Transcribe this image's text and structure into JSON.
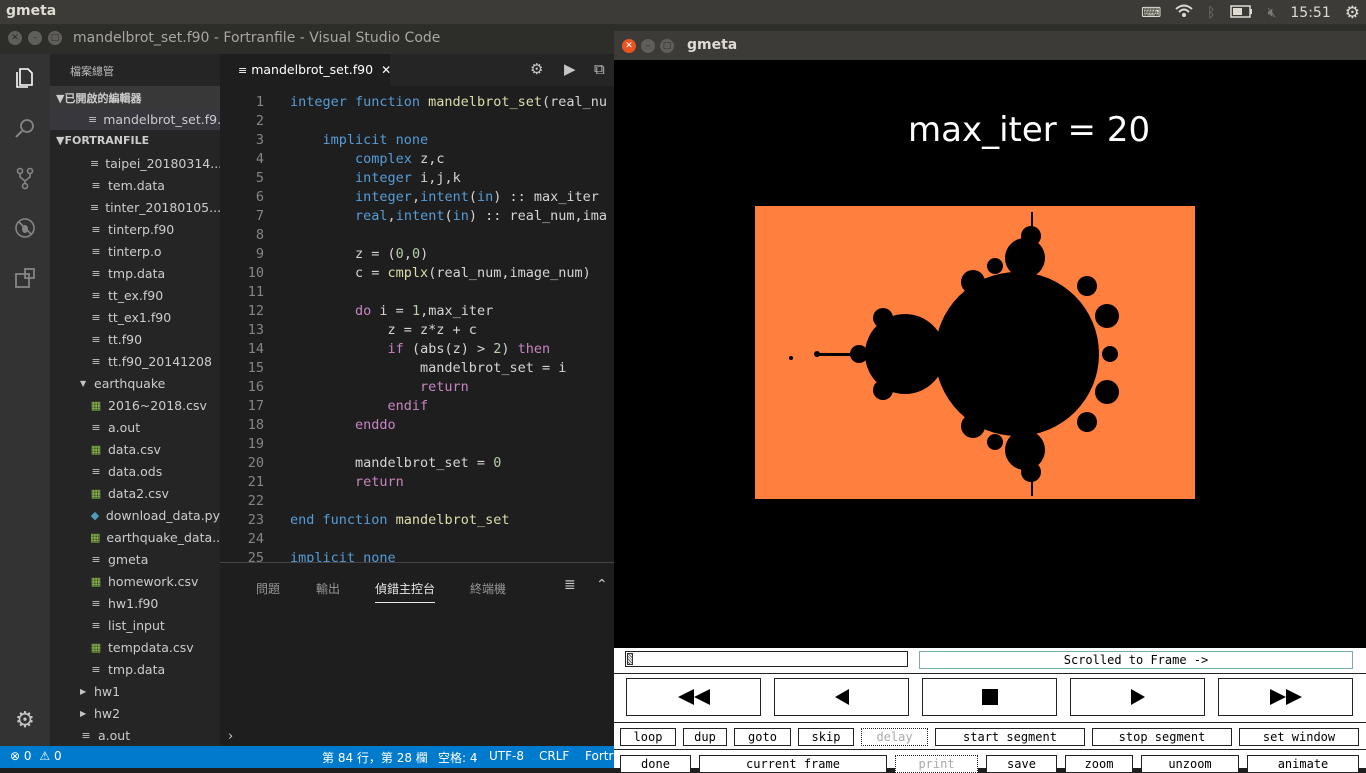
{
  "topbar": {
    "app_name": "gmeta",
    "clock": "15:51",
    "icons": [
      "keyboard-icon",
      "wifi-icon",
      "bluetooth-icon",
      "battery-icon",
      "volume-mute-icon",
      "settings-gear-icon"
    ]
  },
  "vscode": {
    "window_title": "mandelbrot_set.f90 - Fortranfile - Visual Studio Code",
    "explorer_header": "檔案總管",
    "open_editors_label": "已開啟的編輯器",
    "open_editor_file": "mandelbrot_set.f9...",
    "project_label": "FORTRANFILE",
    "files": [
      {
        "name": "taipei_20180314...",
        "type": "file",
        "depth": 1
      },
      {
        "name": "tem.data",
        "type": "file",
        "depth": 1
      },
      {
        "name": "tinter_20180105....",
        "type": "file",
        "depth": 1
      },
      {
        "name": "tinterp.f90",
        "type": "file",
        "depth": 1
      },
      {
        "name": "tinterp.o",
        "type": "file",
        "depth": 1
      },
      {
        "name": "tmp.data",
        "type": "file",
        "depth": 1
      },
      {
        "name": "tt_ex.f90",
        "type": "file",
        "depth": 1
      },
      {
        "name": "tt_ex1.f90",
        "type": "file",
        "depth": 1
      },
      {
        "name": "tt.f90",
        "type": "file",
        "depth": 1
      },
      {
        "name": "tt.f90_20141208",
        "type": "file",
        "depth": 1
      },
      {
        "name": "earthquake",
        "type": "folder-open",
        "depth": 0
      },
      {
        "name": "2016~2018.csv",
        "type": "csv",
        "depth": 1
      },
      {
        "name": "a.out",
        "type": "file",
        "depth": 1
      },
      {
        "name": "data.csv",
        "type": "csv",
        "depth": 1
      },
      {
        "name": "data.ods",
        "type": "file",
        "depth": 1
      },
      {
        "name": "data2.csv",
        "type": "csv",
        "depth": 1
      },
      {
        "name": "download_data.py",
        "type": "py",
        "depth": 1
      },
      {
        "name": "earthquake_data...",
        "type": "csv",
        "depth": 1
      },
      {
        "name": "gmeta",
        "type": "file",
        "depth": 1
      },
      {
        "name": "homework.csv",
        "type": "csv",
        "depth": 1
      },
      {
        "name": "hw1.f90",
        "type": "file",
        "depth": 1
      },
      {
        "name": "list_input",
        "type": "file",
        "depth": 1
      },
      {
        "name": "tempdata.csv",
        "type": "csv",
        "depth": 1
      },
      {
        "name": "tmp.data",
        "type": "file",
        "depth": 1
      },
      {
        "name": "hw1",
        "type": "folder-closed",
        "depth": 0
      },
      {
        "name": "hw2",
        "type": "folder-closed",
        "depth": 0
      },
      {
        "name": "a.out",
        "type": "file",
        "depth": -1
      }
    ],
    "tab_label": "mandelbrot_set.f90",
    "code_lines": [
      {
        "n": "1",
        "segs": [
          [
            "kw",
            "integer function "
          ],
          [
            "fn",
            "mandelbrot_set"
          ],
          [
            "",
            "(real_nu"
          ]
        ]
      },
      {
        "n": "2",
        "segs": []
      },
      {
        "n": "3",
        "segs": [
          [
            "",
            "    "
          ],
          [
            "kw",
            "implicit none"
          ]
        ]
      },
      {
        "n": "4",
        "segs": [
          [
            "",
            "        "
          ],
          [
            "kw",
            "complex"
          ],
          [
            "",
            " z,c"
          ]
        ]
      },
      {
        "n": "5",
        "segs": [
          [
            "",
            "        "
          ],
          [
            "kw",
            "integer"
          ],
          [
            "",
            " i,j,k"
          ]
        ]
      },
      {
        "n": "6",
        "segs": [
          [
            "",
            "        "
          ],
          [
            "kw",
            "integer"
          ],
          [
            "",
            ","
          ],
          [
            "kw",
            "intent"
          ],
          [
            "",
            "("
          ],
          [
            "kw",
            "in"
          ],
          [
            "",
            ") :: max_iter"
          ]
        ]
      },
      {
        "n": "7",
        "segs": [
          [
            "",
            "        "
          ],
          [
            "kw",
            "real"
          ],
          [
            "",
            ","
          ],
          [
            "kw",
            "intent"
          ],
          [
            "",
            "("
          ],
          [
            "kw",
            "in"
          ],
          [
            "",
            ") :: real_num,ima"
          ]
        ]
      },
      {
        "n": "8",
        "segs": []
      },
      {
        "n": "9",
        "segs": [
          [
            "",
            "        z = ("
          ],
          [
            "nm",
            "0"
          ],
          [
            "",
            ","
          ],
          [
            "nm",
            "0"
          ],
          [
            "",
            ")"
          ]
        ]
      },
      {
        "n": "10",
        "segs": [
          [
            "",
            "        c = "
          ],
          [
            "fn",
            "cmplx"
          ],
          [
            "",
            "(real_num,image_num)"
          ]
        ]
      },
      {
        "n": "11",
        "segs": []
      },
      {
        "n": "12",
        "segs": [
          [
            "",
            "        "
          ],
          [
            "ct",
            "do"
          ],
          [
            "",
            " i = "
          ],
          [
            "nm",
            "1"
          ],
          [
            "",
            ",max_iter"
          ]
        ]
      },
      {
        "n": "13",
        "segs": [
          [
            "",
            "            z = z*z + c"
          ]
        ]
      },
      {
        "n": "14",
        "segs": [
          [
            "",
            "            "
          ],
          [
            "ct",
            "if"
          ],
          [
            "",
            " (abs(z) > "
          ],
          [
            "nm",
            "2"
          ],
          [
            "",
            ") "
          ],
          [
            "ct",
            "then"
          ]
        ]
      },
      {
        "n": "15",
        "segs": [
          [
            "",
            "                mandelbrot_set = i"
          ]
        ]
      },
      {
        "n": "16",
        "segs": [
          [
            "",
            "                "
          ],
          [
            "ct",
            "return"
          ]
        ]
      },
      {
        "n": "17",
        "segs": [
          [
            "",
            "            "
          ],
          [
            "ct",
            "endif"
          ]
        ]
      },
      {
        "n": "18",
        "segs": [
          [
            "",
            "        "
          ],
          [
            "ct",
            "enddo"
          ]
        ]
      },
      {
        "n": "19",
        "segs": []
      },
      {
        "n": "20",
        "segs": [
          [
            "",
            "        mandelbrot_set = "
          ],
          [
            "nm",
            "0"
          ]
        ]
      },
      {
        "n": "21",
        "segs": [
          [
            "",
            "        "
          ],
          [
            "ct",
            "return"
          ]
        ]
      },
      {
        "n": "22",
        "segs": []
      },
      {
        "n": "23",
        "segs": [
          [
            "kw",
            "end function "
          ],
          [
            "fn",
            "mandelbrot_set"
          ]
        ]
      },
      {
        "n": "24",
        "segs": []
      },
      {
        "n": "25",
        "segs": [
          [
            "kw",
            "implicit none"
          ]
        ]
      }
    ],
    "panel_tabs": [
      "問題",
      "輸出",
      "偵錯主控台",
      "終端機"
    ],
    "panel_active_tab": "偵錯主控台",
    "panel_prompt": "›",
    "status": {
      "errors": "0",
      "warnings": "0",
      "cursor": "第 84 行，第 28 欄",
      "spaces": "空格: 4",
      "encoding": "UTF-8",
      "eol": "CRLF",
      "language": "Fortra"
    }
  },
  "gmeta": {
    "window_title": "gmeta",
    "plot_title": "max_iter = 20",
    "colors": {
      "background": "#ff7f3f",
      "set": "#000000"
    },
    "frame_label": "Scrolled to Frame ->",
    "transport": [
      "⏪",
      "◀",
      "■",
      "▶",
      "⏩"
    ],
    "transport_names": [
      "rewind-icon",
      "step-back-icon",
      "stop-icon",
      "play-icon",
      "fast-forward-icon"
    ],
    "row1": [
      "loop",
      "dup",
      "goto",
      "skip",
      "delay",
      "start segment",
      "stop segment",
      "set window"
    ],
    "row2": [
      "done",
      "current frame",
      "print",
      "save",
      "zoom",
      "unzoom",
      "animate"
    ]
  }
}
